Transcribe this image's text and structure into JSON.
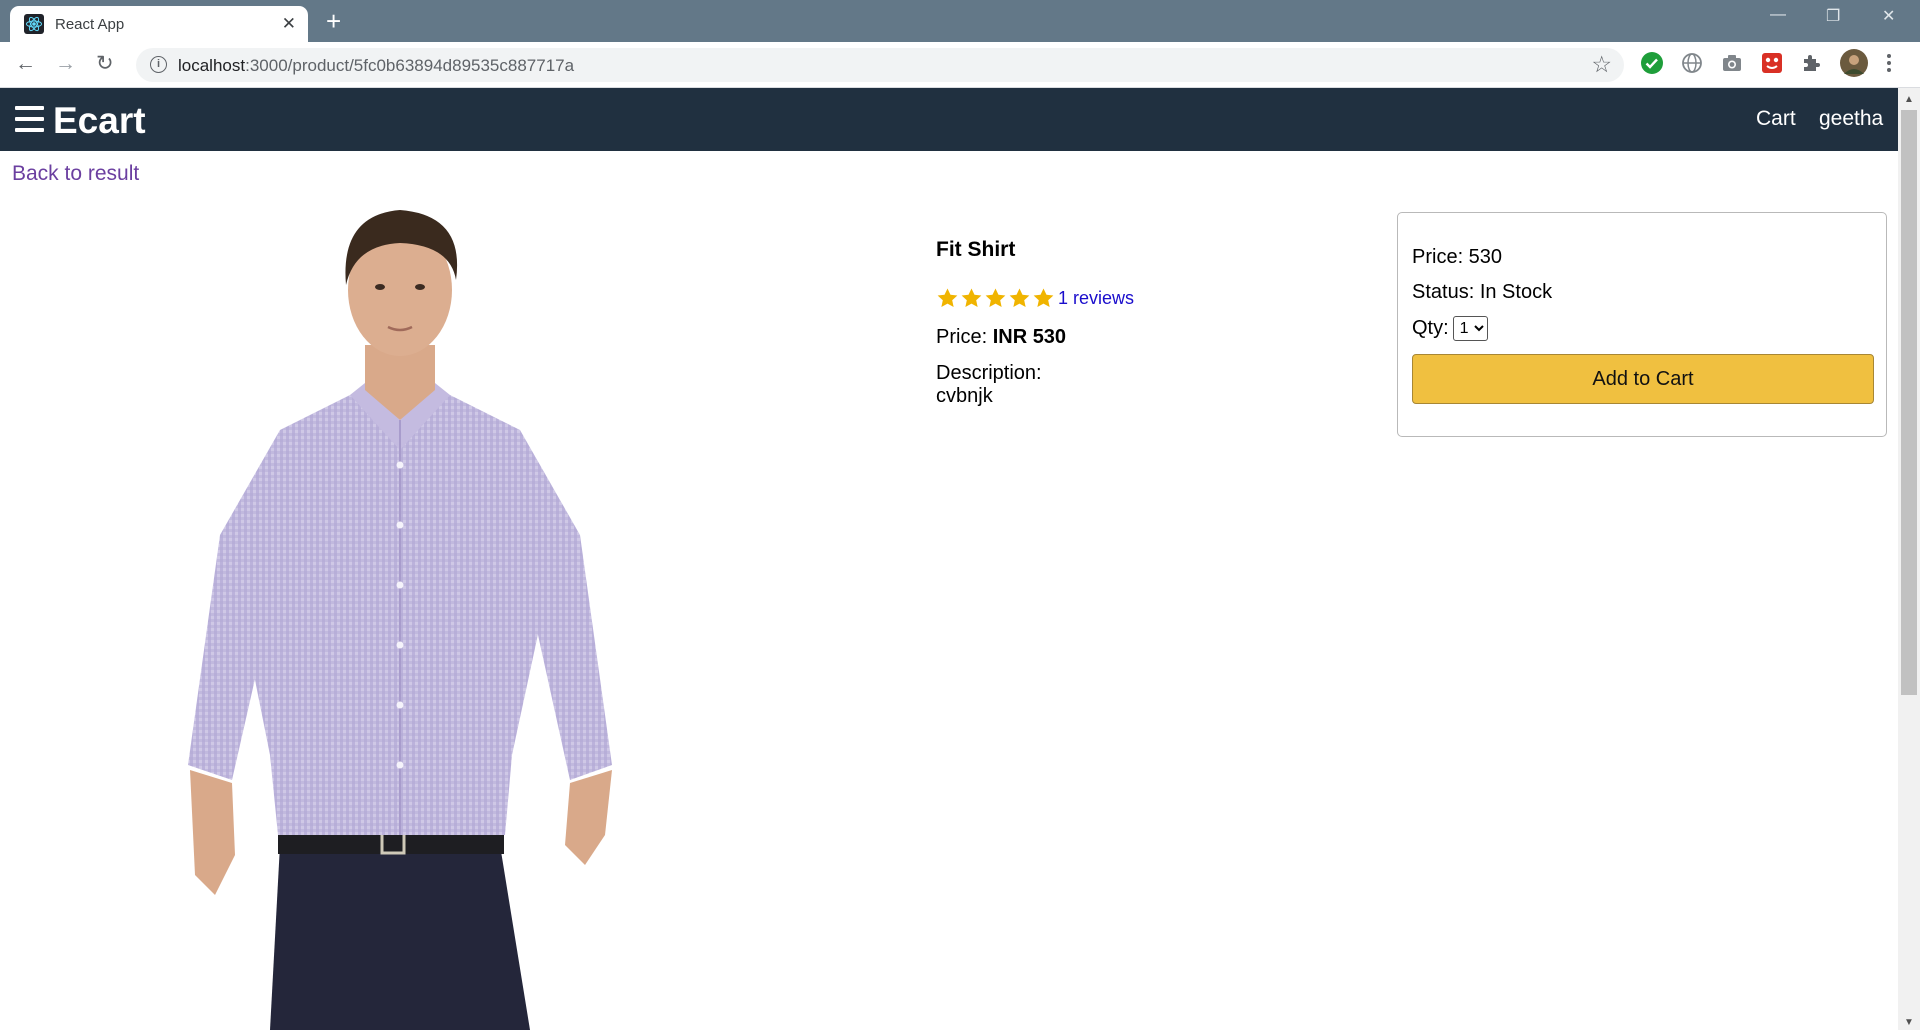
{
  "browser": {
    "tab_title": "React App",
    "tab_close": "✕",
    "new_tab": "+",
    "url_host": "localhost",
    "url_path": ":3000/product/5fc0b63894d89535c887717a",
    "window_controls": {
      "minimize": "—",
      "restore": "❐",
      "close": "✕"
    },
    "nav": {
      "back": "←",
      "forward": "→",
      "reload": "↻"
    },
    "icons": [
      "info-icon",
      "bookmark-star-icon",
      "extension-check-icon",
      "extension-globe-icon",
      "extension-camera-icon",
      "extension-red-icon",
      "extensions-puzzle-icon",
      "profile-avatar",
      "kebab-menu-icon"
    ]
  },
  "header": {
    "brand": "Ecart",
    "cart_link": "Cart",
    "user_link": "geetha"
  },
  "back_link": "Back to result",
  "product": {
    "name": "Fit Shirt",
    "rating": 5,
    "rating_max": 5,
    "reviews_text": "1 reviews",
    "price_label": "Price:",
    "price_value": "INR 530",
    "description_label": "Description:",
    "description": "cvbnjk",
    "star_color": "#f0b400"
  },
  "action_card": {
    "price_text": "Price: 530",
    "status_text": "Status: In Stock",
    "qty_label": "Qty:",
    "qty_selected": "1",
    "add_to_cart": "Add to Cart",
    "button_color": "#f0c040"
  },
  "colors": {
    "header_bg": "#203040",
    "tabbar_bg": "#637888",
    "link_purple": "#6b3fa0"
  }
}
